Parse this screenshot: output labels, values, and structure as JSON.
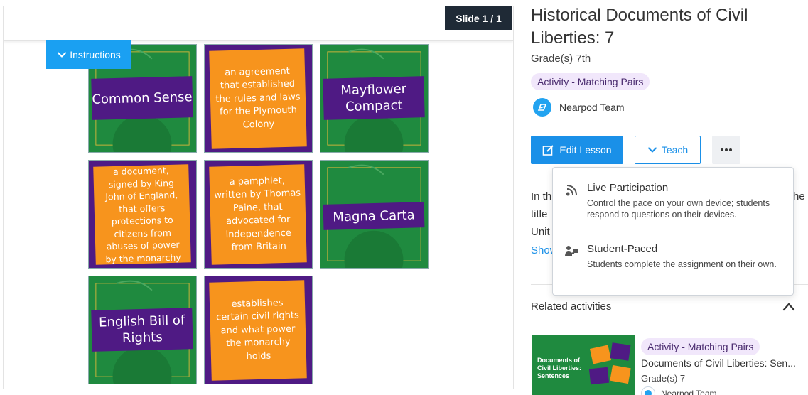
{
  "preview": {
    "slide_counter": "Slide 1 / 1",
    "instructions_label": "Instructions",
    "cards": [
      {
        "kind": "term",
        "text": "Common Sense"
      },
      {
        "kind": "definition",
        "text": "an agreement that established the rules and laws for the Plymouth Colony"
      },
      {
        "kind": "term",
        "text": "Mayflower Compact"
      },
      {
        "kind": "definition",
        "text": "a document, signed by King John of England, that offers protections to citizens from abuses of power by the monarchy"
      },
      {
        "kind": "definition",
        "text": "a pamphlet, written by Thomas Paine, that advocated for independence from Britain"
      },
      {
        "kind": "term",
        "text": "Magna Carta"
      },
      {
        "kind": "term",
        "text": "English Bill of Rights"
      },
      {
        "kind": "definition",
        "text": "establishes certain civil rights and what power the monarchy holds"
      }
    ]
  },
  "lesson": {
    "title": "Historical Documents of Civil Liberties: 7",
    "grade": "Grade(s) 7th",
    "type_badge": "Activity - Matching Pairs",
    "author": "Nearpod Team",
    "edit_label": "Edit Lesson",
    "teach_label": "Teach",
    "more_label": "•••",
    "description_lines": [
      "In th",
      "title",
      "Unit"
    ],
    "description_right": "he",
    "show_more": "Show"
  },
  "teach_menu": {
    "items": [
      {
        "title": "Live Participation",
        "description": "Control the pace on your own device; students respond to questions on their devices."
      },
      {
        "title": "Student-Paced",
        "description": "Students complete the assignment on their own."
      }
    ]
  },
  "related": {
    "title": "Related activities",
    "items": [
      {
        "thumb_text": "Documents of Civil Liberties: Sentences",
        "badge": "Activity - Matching Pairs",
        "name": "Documents of Civil Liberties: Sen...",
        "grade": "Grade(s) 7",
        "author": "Nearpod Team"
      }
    ]
  },
  "colors": {
    "brand_blue": "#1a90e8",
    "card_green": "#1f8a3f",
    "card_purple": "#4f1a84",
    "card_orange": "#f7941d",
    "badge_bg": "#f1e7fb",
    "slide_counter_bg": "#1f2a36"
  }
}
